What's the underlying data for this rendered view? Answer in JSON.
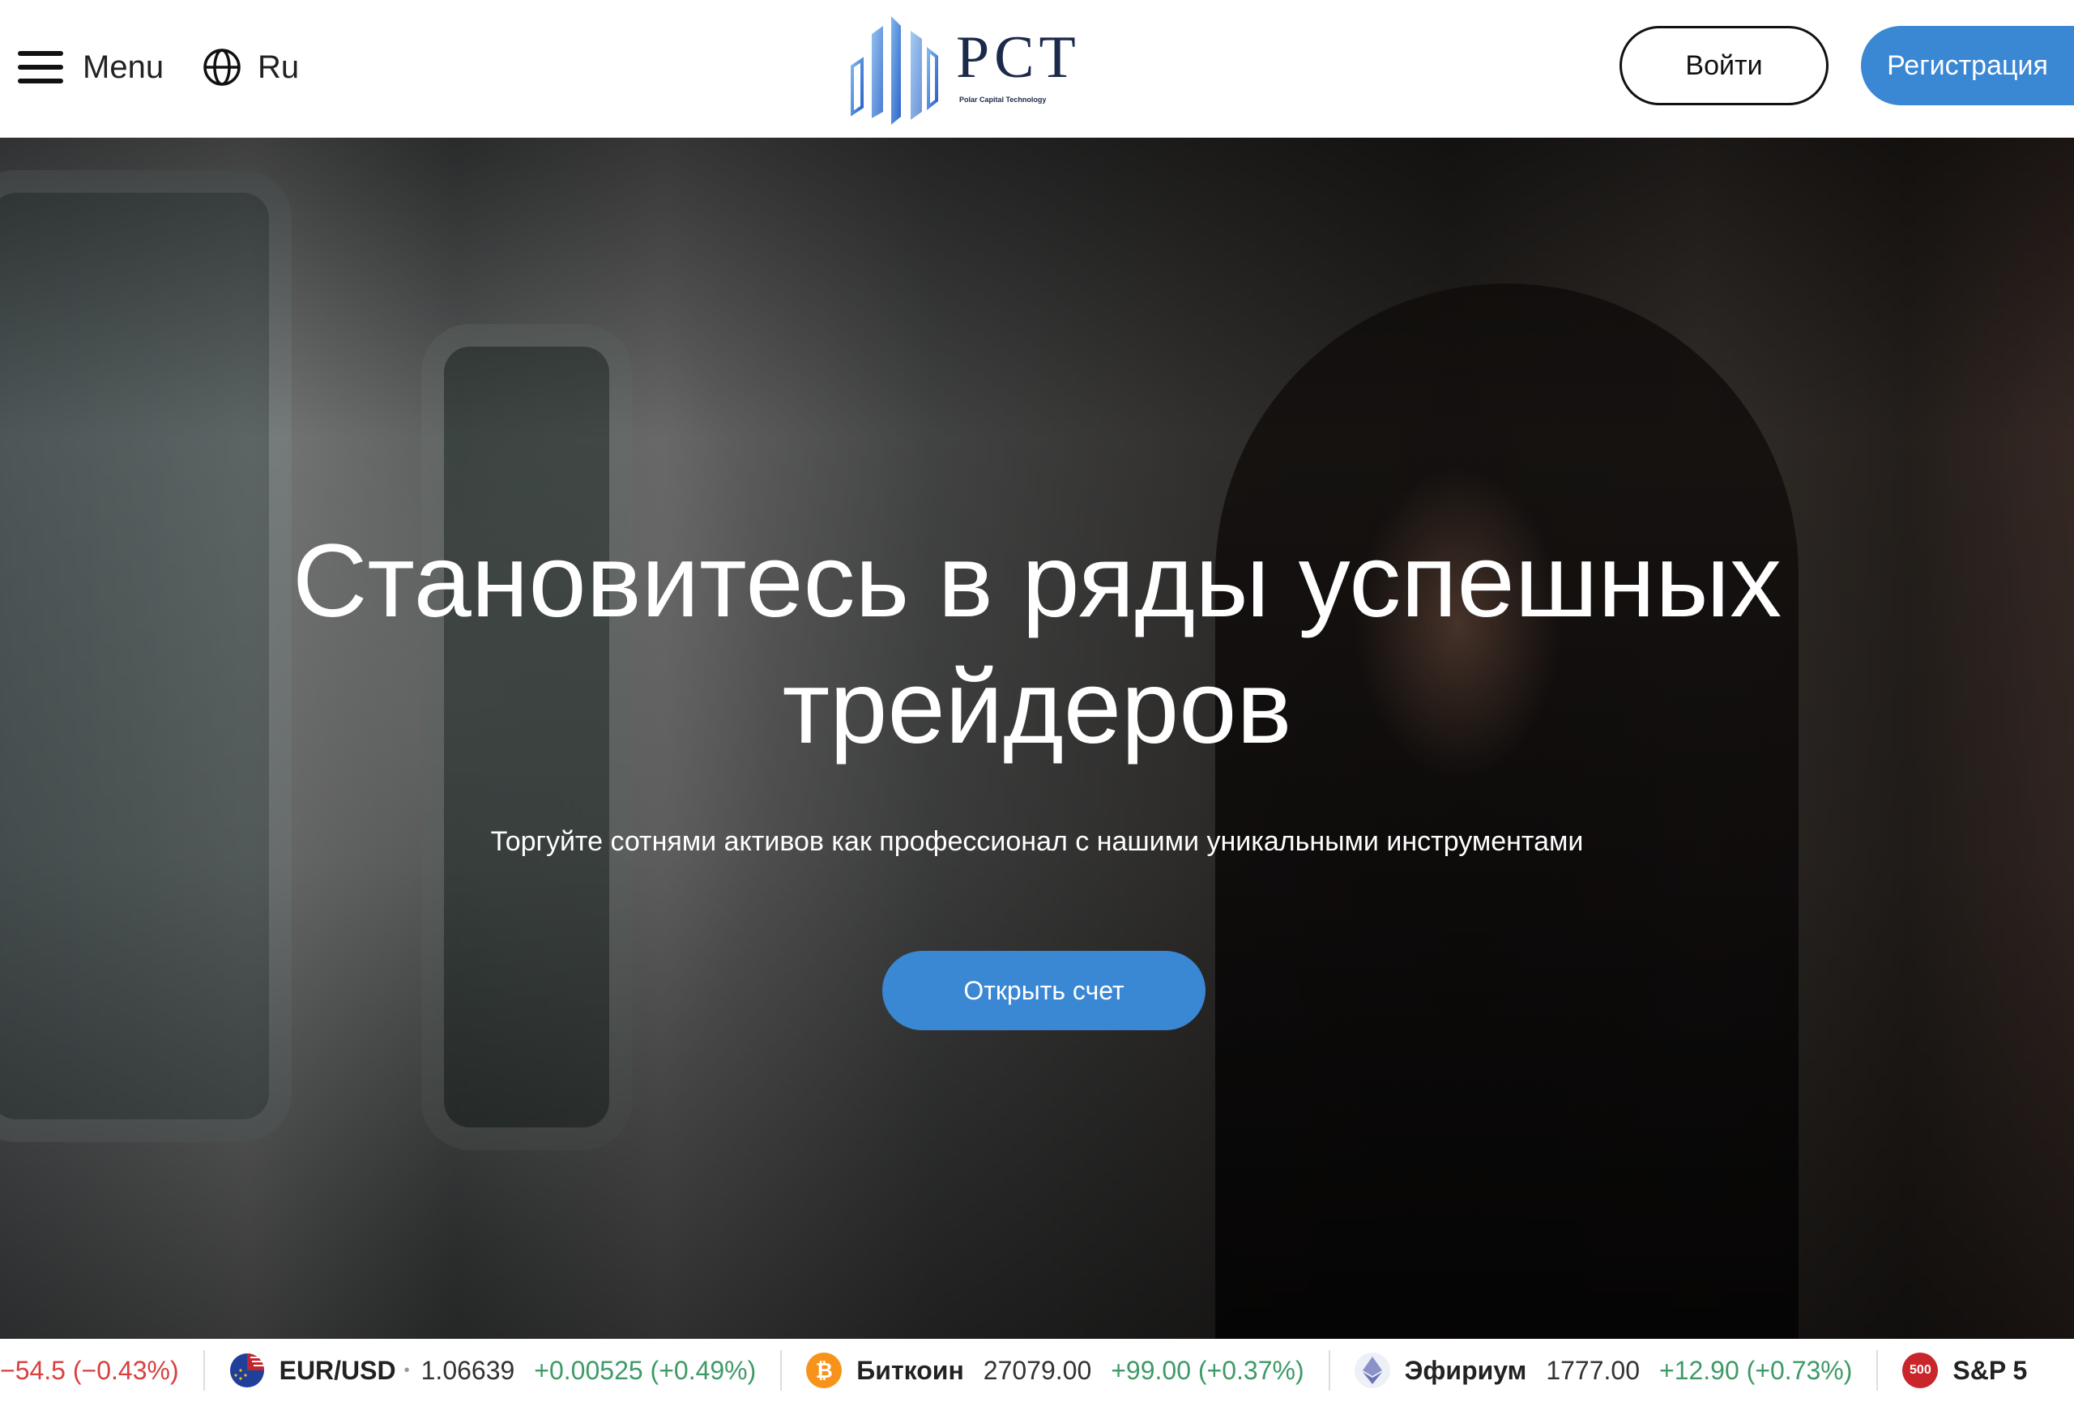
{
  "header": {
    "menu_label": "Menu",
    "language_label": "Ru",
    "logo_text": "PCT",
    "logo_subtitle": "Polar Capital Technology",
    "login_label": "Войти",
    "register_label": "Регистрация"
  },
  "hero": {
    "title_line1": "Становитесь в ряды успешных",
    "title_line2": "трейдеров",
    "subtitle": "Торгуйте сотнями активов как профессионал с нашими уникальными инструментами",
    "cta_label": "Открыть счет"
  },
  "ticker": {
    "partial_change": "−54.5 (−0.43%)",
    "items": [
      {
        "name": "EUR/USD",
        "price": "1.06639",
        "change": "+0.00525 (+0.49%)",
        "icon": "eu-us-flag-icon"
      },
      {
        "name": "Биткоин",
        "price": "27079.00",
        "change": "+99.00 (+0.37%)",
        "icon": "bitcoin-icon"
      },
      {
        "name": "Эфириум",
        "price": "1777.00",
        "change": "+12.90 (+0.73%)",
        "icon": "ethereum-icon"
      },
      {
        "name": "S&P 5",
        "icon_text": "500",
        "icon": "sp500-icon"
      }
    ]
  },
  "colors": {
    "accent_blue": "#3a87d4",
    "positive": "#3f9a68",
    "negative": "#d94040"
  }
}
